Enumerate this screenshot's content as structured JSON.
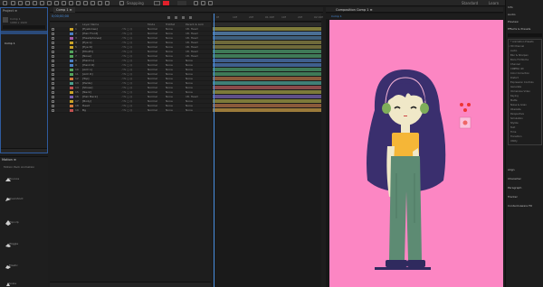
{
  "toolbar": {
    "snapping_label": "Snapping",
    "workspace_label": "Standard",
    "learn_label": "Learn",
    "search_label": "Search Help"
  },
  "project": {
    "tab_label": "Project ≡",
    "lines": [
      "Comp 1",
      "1080 x 1920",
      "0;00;10;00"
    ],
    "selected_item": "Comp 1"
  },
  "effects_panel": {
    "tab_label": "Motion ≡",
    "title": "Motion Pack Animation",
    "items": [
      "Bounce",
      "Overshoot",
      "Pop-Up",
      "Wiggle",
      "Elastic",
      "Scale"
    ]
  },
  "timeline": {
    "tab_label": "Comp 1 ≡",
    "timecode": "0;00;00;00",
    "columns": {
      "num": "#",
      "name": "Layer Name",
      "mode": "Mode",
      "trkmat": "TrkMat",
      "parent": "Parent & Link"
    },
    "layers": [
      {
        "num": "1",
        "name": "[Eyebrows]",
        "mode": "Normal",
        "trk": "None",
        "parent": "18. Head",
        "color": "#c9a227"
      },
      {
        "num": "2",
        "name": "[Hair Front]",
        "mode": "Normal",
        "trk": "None",
        "parent": "18. Head",
        "color": "#4a7fc1"
      },
      {
        "num": "3",
        "name": "[Headphones]",
        "mode": "Normal",
        "trk": "None",
        "parent": "18. Head",
        "color": "#a65aa8"
      },
      {
        "num": "4",
        "name": "[Eye L]",
        "mode": "Normal",
        "trk": "None",
        "parent": "18. Head",
        "color": "#c9a227"
      },
      {
        "num": "5",
        "name": "[Eye R]",
        "mode": "Normal",
        "trk": "None",
        "parent": "18. Head",
        "color": "#c9a227"
      },
      {
        "num": "6",
        "name": "[Mouth]",
        "mode": "Normal",
        "trk": "None",
        "parent": "18. Head",
        "color": "#53a35c"
      },
      {
        "num": "7",
        "name": "[Nose]",
        "mode": "Normal",
        "trk": "None",
        "parent": "18. Head",
        "color": "#53a35c"
      },
      {
        "num": "8",
        "name": "[Hand L]",
        "mode": "Normal",
        "trk": "None",
        "parent": "None",
        "color": "#4a7fc1"
      },
      {
        "num": "9",
        "name": "[Hand R]",
        "mode": "Normal",
        "trk": "None",
        "parent": "None",
        "color": "#4a7fc1"
      },
      {
        "num": "10",
        "name": "[Arm L]",
        "mode": "Normal",
        "trk": "None",
        "parent": "None",
        "color": "#53a35c"
      },
      {
        "num": "11",
        "name": "[Arm R]",
        "mode": "Normal",
        "trk": "None",
        "parent": "None",
        "color": "#53a35c"
      },
      {
        "num": "12",
        "name": "[Top]",
        "mode": "Normal",
        "trk": "None",
        "parent": "None",
        "color": "#d0783a"
      },
      {
        "num": "13",
        "name": "[Pants]",
        "mode": "Normal",
        "trk": "None",
        "parent": "None",
        "color": "#4a9f8c"
      },
      {
        "num": "14",
        "name": "[Shoes]",
        "mode": "Normal",
        "trk": "None",
        "parent": "None",
        "color": "#c05050"
      },
      {
        "num": "15",
        "name": "[Neck]",
        "mode": "Normal",
        "trk": "None",
        "parent": "None",
        "color": "#c9a227"
      },
      {
        "num": "16",
        "name": "[Hair Back]",
        "mode": "Normal",
        "trk": "None",
        "parent": "18. Head",
        "color": "#7a5fb0"
      },
      {
        "num": "17",
        "name": "[Body]",
        "mode": "Normal",
        "trk": "None",
        "parent": "None",
        "color": "#c9a227"
      },
      {
        "num": "18",
        "name": "Head",
        "mode": "Normal",
        "trk": "None",
        "parent": "None",
        "color": "#d0783a"
      },
      {
        "num": "19",
        "name": "Bg",
        "mode": "Normal",
        "trk": "None",
        "parent": "None",
        "color": "#c05050"
      }
    ],
    "bar_colors": [
      "#7d7a3a",
      "#4a6f95",
      "#3f5f7d",
      "#6e6a3a",
      "#6e6a3a",
      "#3f7a57",
      "#3f7a57",
      "#3f5f8d",
      "#3f5f8d",
      "#3f7a57",
      "#3f7a57",
      "#8a5a3a",
      "#3f7f77",
      "#8a4a4a",
      "#7d7a3a",
      "#5f4f8a",
      "#7d7a3a",
      "#8a5a3a",
      "#9a7a3a"
    ],
    "ruler_labels": [
      "0f",
      "10f",
      "20f",
      "01:00f",
      "10f",
      "20f",
      "02:00f"
    ]
  },
  "composition": {
    "tab_label": "Composition Comp 1 ≡",
    "sub_label": "Comp 1",
    "background": "#fc86c3"
  },
  "right_panel": {
    "sections": [
      "Info",
      "Audio",
      "Preview",
      "Effects & Presets"
    ],
    "search_placeholder": "⌕",
    "presets": [
      "* Animation Presets",
      "3D Channel",
      "Audio",
      "Blur & Sharpen",
      "Boris FX Mocha",
      "Channel",
      "CINEMA 4D",
      "Color Correction",
      "Distort",
      "Expression Controls",
      "Generate",
      "Immersive Video",
      "Keying",
      "Matte",
      "Noise & Grain",
      "Obsolete",
      "Perspective",
      "Simulation",
      "Stylize",
      "Text",
      "Time",
      "Transition",
      "Utility"
    ],
    "bottom_sections": [
      "Align",
      "Character",
      "Paragraph",
      "Tracker",
      "Content-Aware Fill"
    ]
  }
}
